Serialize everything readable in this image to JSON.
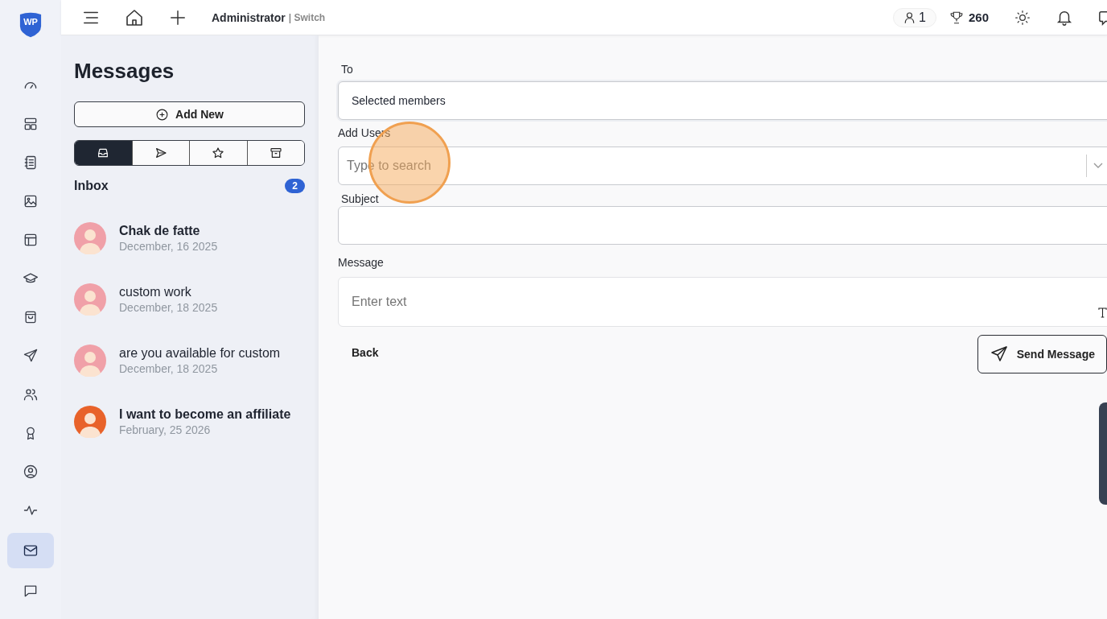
{
  "logo": {
    "text": "WP"
  },
  "rail": [
    {
      "kind": "gauge",
      "selected": false
    },
    {
      "kind": "layout",
      "selected": false
    },
    {
      "kind": "notebook",
      "selected": false
    },
    {
      "kind": "image",
      "selected": false
    },
    {
      "kind": "panel",
      "selected": false
    },
    {
      "kind": "cap",
      "selected": false
    },
    {
      "kind": "bag",
      "selected": false
    },
    {
      "kind": "send",
      "selected": false
    },
    {
      "kind": "users",
      "selected": false
    },
    {
      "kind": "award",
      "selected": false
    },
    {
      "kind": "user",
      "selected": false
    },
    {
      "kind": "pulse",
      "selected": false
    },
    {
      "kind": "mail",
      "selected": true
    },
    {
      "kind": "chat",
      "selected": false
    }
  ],
  "topbar": {
    "role": "Administrator",
    "switch": "| Switch",
    "online": "1",
    "points": "260"
  },
  "messages": {
    "title": "Messages",
    "add_button": "Add New",
    "tabs": [
      {
        "kind": "inbox",
        "selected": true
      },
      {
        "kind": "send",
        "selected": false
      },
      {
        "kind": "star",
        "selected": false
      },
      {
        "kind": "archive",
        "selected": false
      }
    ],
    "folder": "Inbox",
    "count": "2",
    "items": [
      {
        "subject": "Chak de fatte",
        "date": "December, 16 2025",
        "unread": true,
        "color": "#f0a0a8"
      },
      {
        "subject": "custom work",
        "date": "December, 18 2025",
        "unread": false,
        "color": "#f0a0a8"
      },
      {
        "subject": "are you available for custom",
        "date": "December, 18 2025",
        "unread": false,
        "color": "#f0a0a8"
      },
      {
        "subject": "I want to become an affiliate",
        "date": "February, 25 2026",
        "unread": true,
        "color": "#e8622a"
      }
    ]
  },
  "form": {
    "to_label": "To",
    "to_value": "Selected members",
    "users_label": "Add Users",
    "users_placeholder": "Type to search",
    "click_highlight": true,
    "subject_label": "Subject",
    "message_label": "Message",
    "message_placeholder": "Enter text",
    "back": "Back",
    "send": "Send Message"
  }
}
